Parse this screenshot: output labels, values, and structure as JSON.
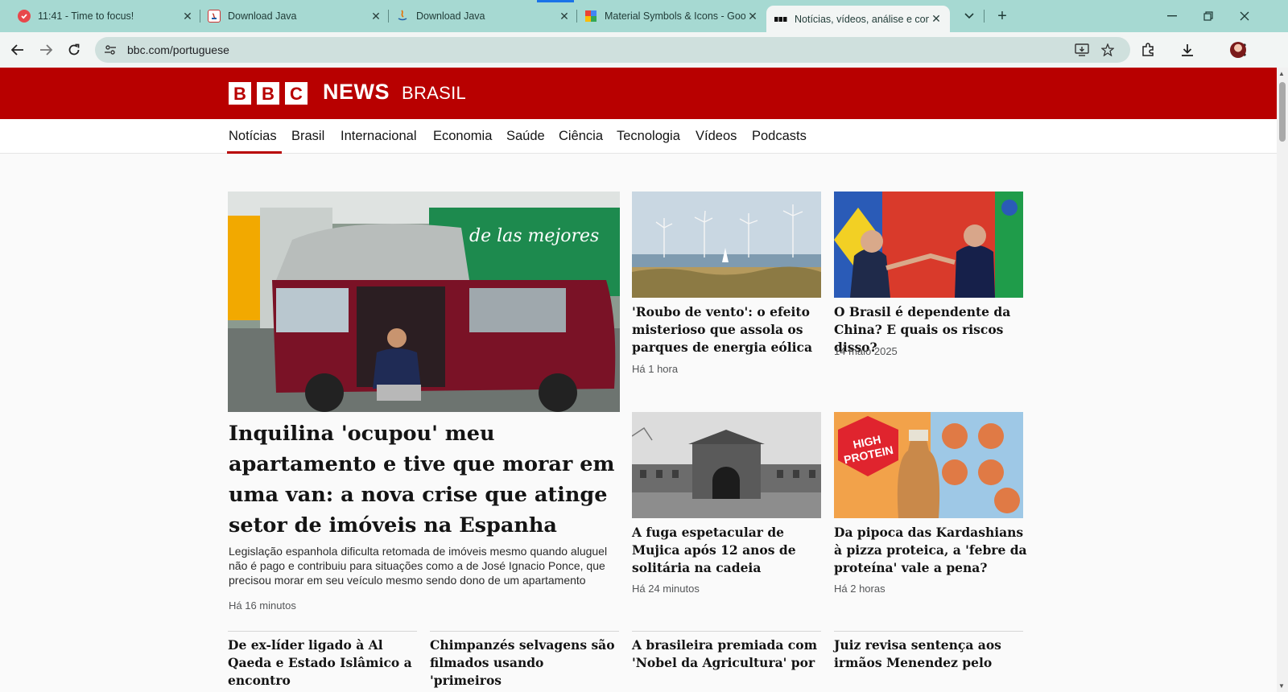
{
  "tabs": [
    {
      "title": "11:41 - Time to focus!",
      "icon": "check-circle-icon"
    },
    {
      "title": "Download Java",
      "icon": "java-icon"
    },
    {
      "title": "Download Java",
      "icon": "java-icon"
    },
    {
      "title": "Material Symbols & Icons - Goo",
      "icon": "material-icon"
    },
    {
      "title": "Notícias, vídeos, análise e conte",
      "icon": "bbc-icon"
    }
  ],
  "address_bar": {
    "url": "bbc.com/portuguese"
  },
  "site": {
    "logo_letters": [
      "B",
      "B",
      "C"
    ],
    "logo_news": "NEWS",
    "logo_edition": "BRASIL",
    "brand_color": "#b80000"
  },
  "nav": [
    "Notícias",
    "Brasil",
    "Internacional",
    "Economia",
    "Saúde",
    "Ciência",
    "Tecnologia",
    "Vídeos",
    "Podcasts"
  ],
  "lead": {
    "title": "Inquilina 'ocupou' meu apartamento e tive que morar em uma van: a nova crise que atinge setor de imóveis na Espanha",
    "summary": "Legislação espanhola dificulta retomada de imóveis mesmo quando aluguel não é pago e contribuiu para situações como a de José Ignacio Ponce, que precisou morar em seu veículo mesmo sendo dono de um apartamento",
    "time": "Há 16 minutos",
    "image_text": "de las mejores"
  },
  "stories": [
    {
      "title": "'Roubo de vento': o efeito misterioso que assola os parques de energia eólica",
      "time": "Há 1 hora"
    },
    {
      "title": "O Brasil é dependente da China? E quais os riscos disso?",
      "time": "14 maio 2025"
    },
    {
      "title": "A fuga espetacular de Mujica após 12 anos de solitária na cadeia",
      "time": "Há 24 minutos"
    },
    {
      "title": "Da pipoca das Kardashians à pizza proteica, a 'febre da proteína' vale a pena?",
      "time": "Há 2 horas",
      "image_text": [
        "HIGH",
        "PROTEIN"
      ]
    }
  ],
  "bottom_stories": [
    {
      "title": "De ex-líder ligado à Al Qaeda e Estado Islâmico a encontro"
    },
    {
      "title": "Chimpanzés selvagens são filmados usando 'primeiros"
    },
    {
      "title": "A brasileira premiada com 'Nobel da Agricultura' por"
    },
    {
      "title": "Juiz revisa sentença aos irmãos Menendez pelo"
    }
  ]
}
